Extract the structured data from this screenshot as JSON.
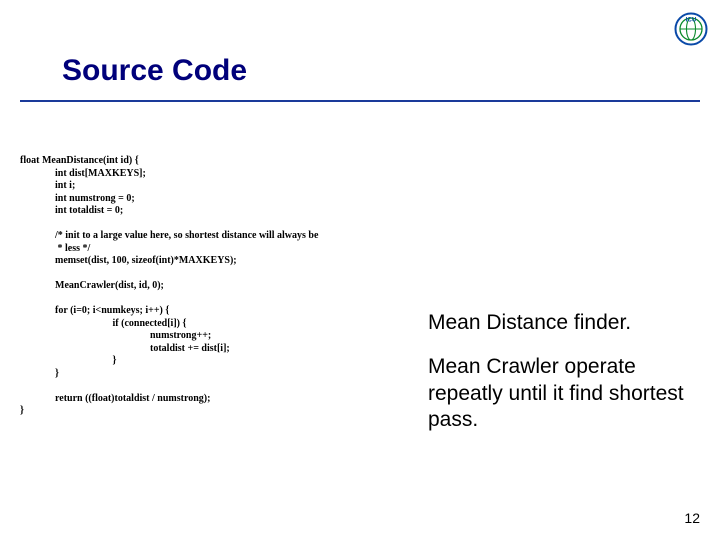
{
  "slide": {
    "title": "Source Code",
    "logo_letters": "ICU",
    "page_number": "12"
  },
  "code_lines": [
    "float MeanDistance(int id) {",
    "              int dist[MAXKEYS];",
    "              int i;",
    "              int numstrong = 0;",
    "              int totaldist = 0;",
    "",
    "              /* init to a large value here, so shortest distance will always be",
    "               * less */",
    "              memset(dist, 100, sizeof(int)*MAXKEYS);",
    "",
    "              MeanCrawler(dist, id, 0);",
    "",
    "              for (i=0; i<numkeys; i++) {",
    "                                     if (connected[i]) {",
    "                                                    numstrong++;",
    "                                                    totaldist += dist[i];",
    "                                     }",
    "              }",
    "",
    "              return ((float)totaldist / numstrong);",
    "}"
  ],
  "explain": {
    "p1": "Mean Distance finder.",
    "p2": "Mean Crawler operate repeatly until it find shortest pass."
  }
}
